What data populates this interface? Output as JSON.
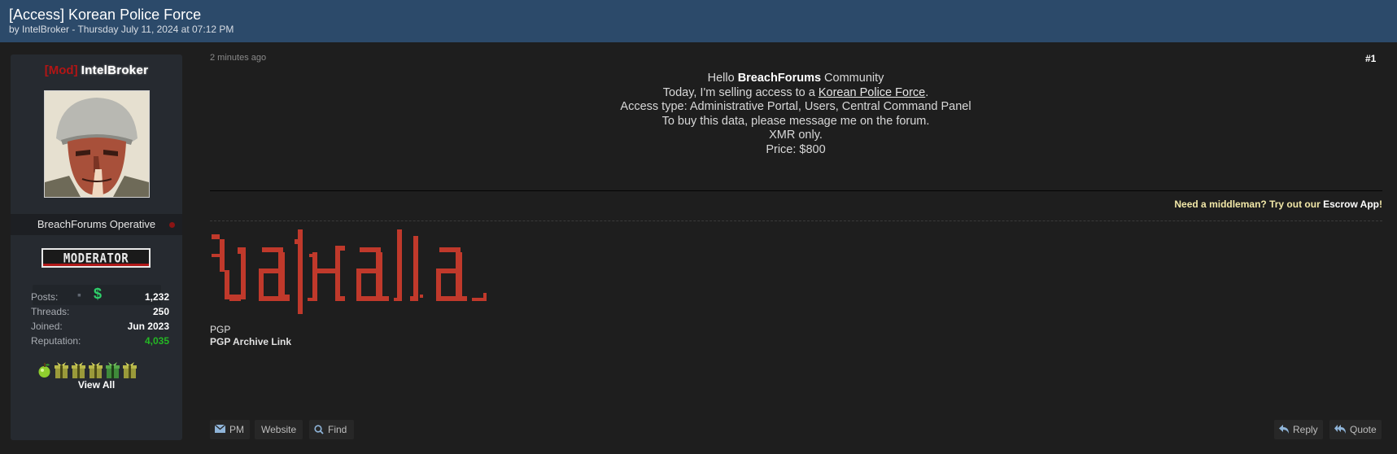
{
  "thread": {
    "title": "[Access] Korean Police Force",
    "meta": "by IntelBroker - Thursday July 11, 2024 at 07:12 PM"
  },
  "author": {
    "mod_tag": "[Mod]",
    "username": "IntelBroker",
    "usertitle": "BreachForums Operative",
    "rank": "MODERATOR",
    "award_strip_symbol": "$",
    "stats": [
      {
        "label": "Posts:",
        "value": "1,232"
      },
      {
        "label": "Threads:",
        "value": "250"
      },
      {
        "label": "Joined:",
        "value": "Jun 2023"
      },
      {
        "label": "Reputation:",
        "value": "4,035"
      }
    ],
    "view_all": "View All",
    "award_icons": [
      "apple-icon",
      "gift-icon",
      "gift-icon",
      "gift-icon",
      "gift-icon",
      "gift-icon"
    ]
  },
  "post": {
    "time": "2 minutes ago",
    "number": "#1",
    "lines": {
      "hello_pre": "Hello ",
      "hello_bold": "BreachForums",
      "hello_post": " Community",
      "selling_pre": "Today, I'm selling access to a ",
      "selling_link": "Korean Police Force",
      "selling_post": ".",
      "access_type": "Access type: Administrative Portal, Users, Central Command Panel",
      "buy": "To buy this data, please message me on the forum.",
      "xmr": "XMR only.",
      "price": "Price: $800"
    },
    "middleman": {
      "p1": "Need a ",
      "p2": "middleman",
      "p3": "? Try out our ",
      "p4": "Escrow App",
      "p5": "!"
    },
    "signature": {
      "banner_text": "valhalla",
      "pgp": "PGP",
      "pgp_archive": "PGP Archive Link"
    }
  },
  "buttons": {
    "pm": "PM",
    "website": "Website",
    "find": "Find",
    "reply": "Reply",
    "quote": "Quote"
  },
  "colors": {
    "header_bg": "#2c4a6a",
    "page_bg": "#1e1e1e",
    "postbit_bg": "#262a30",
    "mod_red": "#b31515",
    "reputation_green": "#24b724",
    "banner_red": "#c0392b"
  }
}
